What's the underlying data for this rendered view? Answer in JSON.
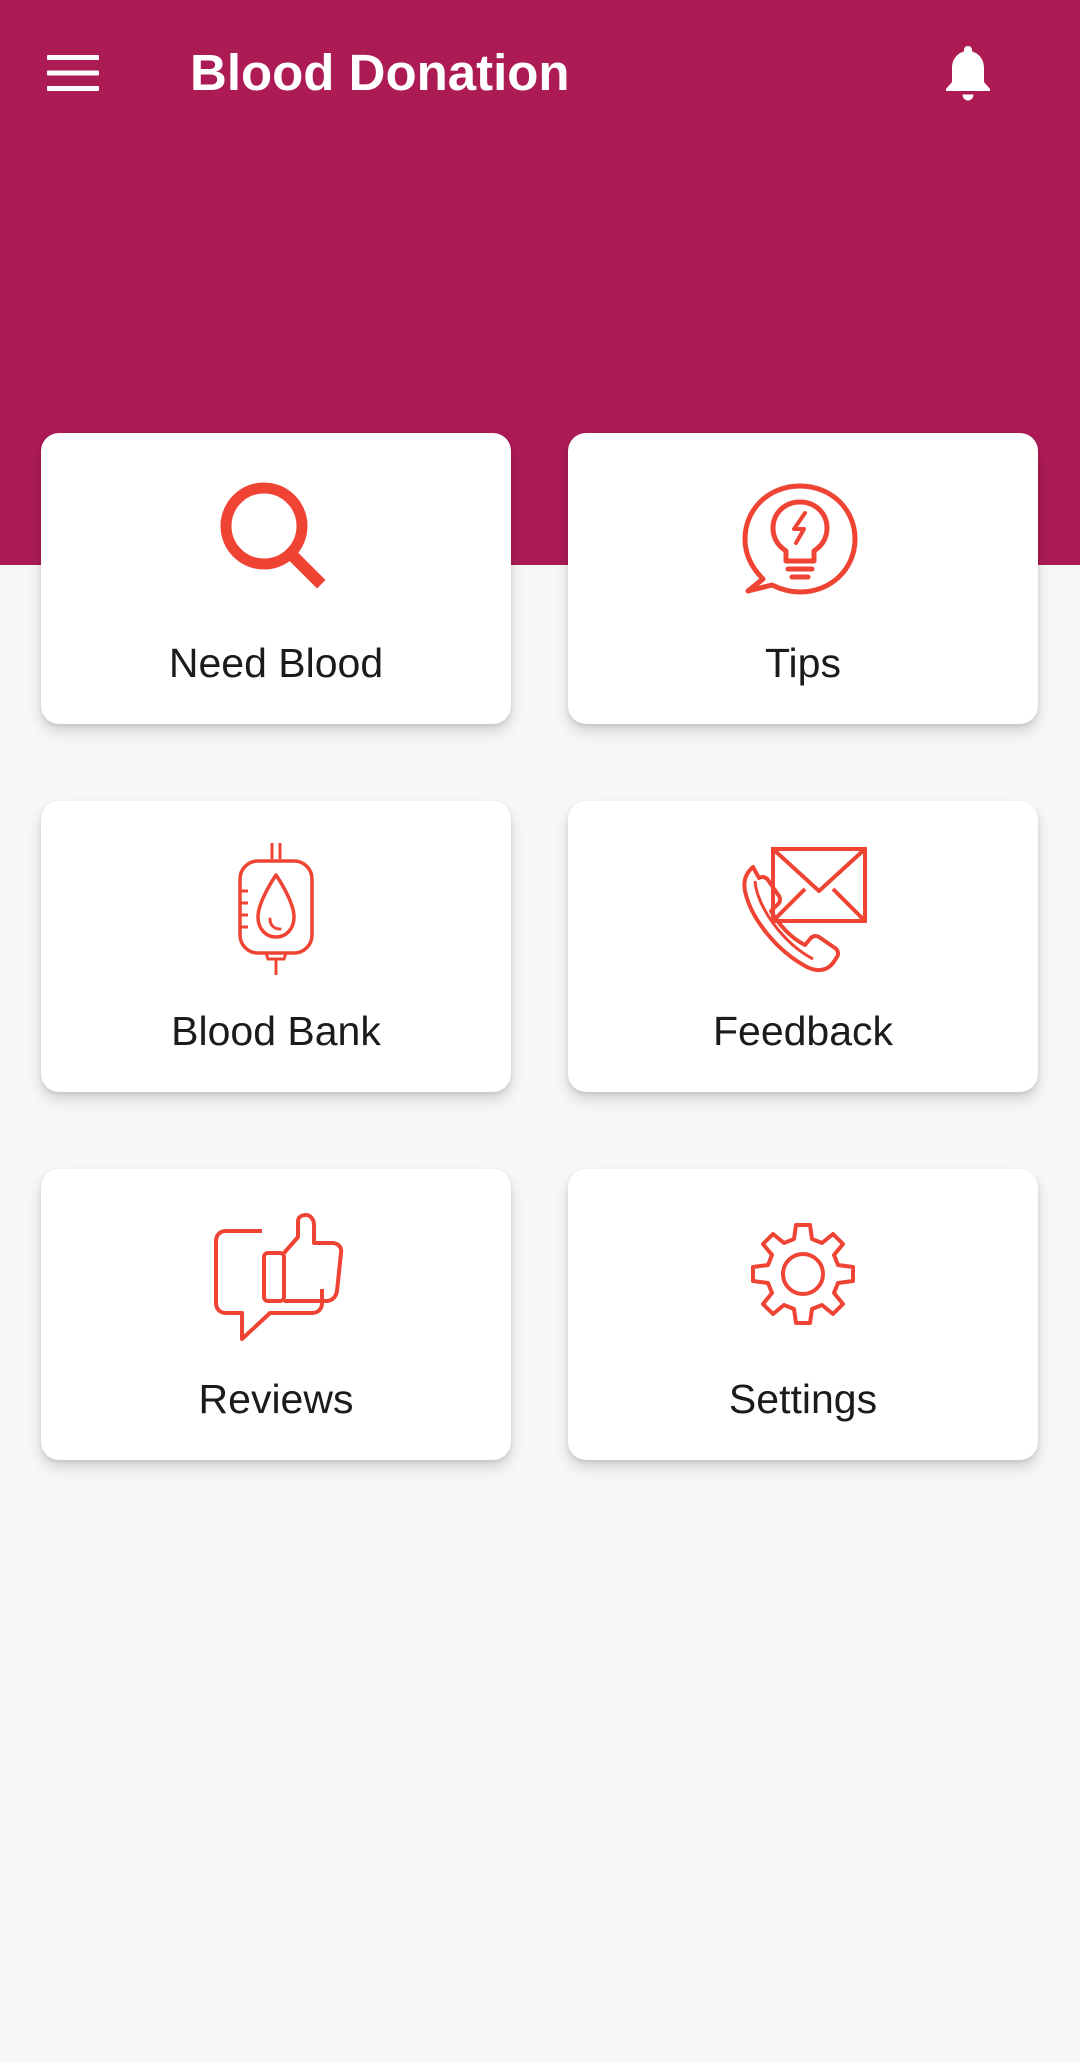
{
  "app": {
    "title": "Blood Donation",
    "menu_icon": "hamburger-menu-icon",
    "notification_icon": "bell-icon"
  },
  "colors": {
    "header": "#ad1b55",
    "accent": "#ef4434",
    "background": "#f7f7f7",
    "card": "#ffffff"
  },
  "dashboard": {
    "cards": [
      {
        "label": "Need Blood",
        "icon": "search-icon"
      },
      {
        "label": "Tips",
        "icon": "lightbulb-chat-icon"
      },
      {
        "label": "Blood Bank",
        "icon": "blood-bag-icon"
      },
      {
        "label": "Feedback",
        "icon": "phone-mail-icon"
      },
      {
        "label": "Reviews",
        "icon": "thumbs-up-chat-icon"
      },
      {
        "label": "Settings",
        "icon": "gear-icon"
      }
    ]
  }
}
